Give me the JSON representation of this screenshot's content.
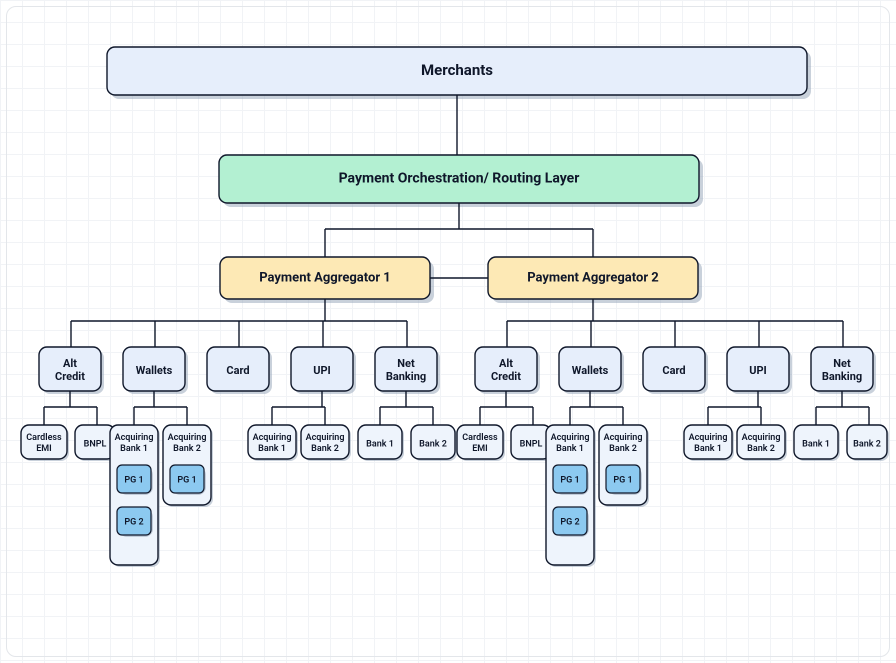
{
  "merchants": "Merchants",
  "orchestration": "Payment Orchestration/ Routing Layer",
  "agg1": "Payment Aggregator 1",
  "agg2": "Payment Aggregator 2",
  "altcredit": "Alt\nCredit",
  "wallets": "Wallets",
  "card": "Card",
  "upi": "UPI",
  "netbanking": "Net\nBanking",
  "cardless": "Cardless\nEMI",
  "bnpl": "BNPL",
  "acq1": "Acquiring\nBank 1",
  "acq2": "Acquiring\nBank 2",
  "bank1": "Bank 1",
  "bank2": "Bank 2",
  "pg1": "PG 1",
  "pg2": "PG 2",
  "colors": {
    "merchants": "#e6eefb",
    "orch": "#b3f0d2",
    "agg": "#fde9b5",
    "method": "#e6eefb",
    "leaf": "#eef4fc",
    "pg": "#8cc9f0"
  }
}
